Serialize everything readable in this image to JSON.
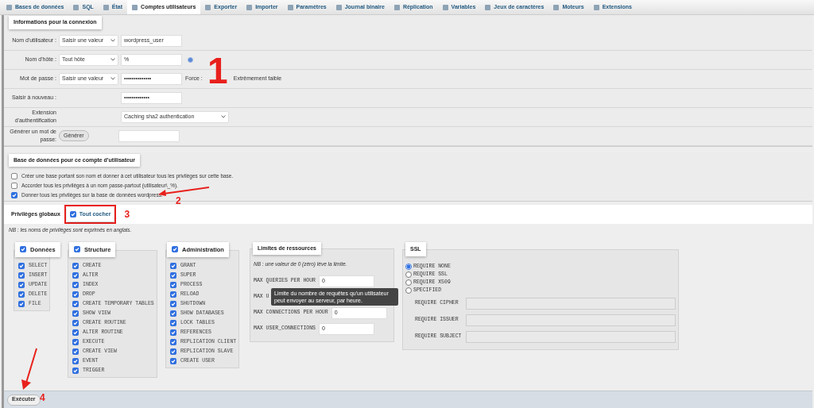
{
  "tabs": [
    {
      "label": "Bases de données",
      "selected": false
    },
    {
      "label": "SQL",
      "selected": false
    },
    {
      "label": "État",
      "selected": false
    },
    {
      "label": "Comptes utilisateurs",
      "selected": true
    },
    {
      "label": "Exporter",
      "selected": false
    },
    {
      "label": "Importer",
      "selected": false
    },
    {
      "label": "Paramètres",
      "selected": false
    },
    {
      "label": "Journal binaire",
      "selected": false
    },
    {
      "label": "Réplication",
      "selected": false
    },
    {
      "label": "Variables",
      "selected": false
    },
    {
      "label": "Jeux de caractères",
      "selected": false
    },
    {
      "label": "Moteurs",
      "selected": false
    },
    {
      "label": "Extensions",
      "selected": false
    }
  ],
  "connection": {
    "legend": "Informations pour la connexion",
    "rows": [
      {
        "kind": "select_input",
        "label": "Nom d'utilisateur :",
        "select": "Saisir une valeur",
        "value": "wordpress_user",
        "help": false
      },
      {
        "kind": "select_input",
        "label": "Nom d'hôte :",
        "select": "Tout hôte",
        "value": "%",
        "help": true
      },
      {
        "kind": "password",
        "label": "Mot de passe :",
        "select": "Saisir une valeur",
        "value": "••••••••••••••",
        "strength_label": "Force :",
        "strength": "Extrêmement faible"
      },
      {
        "kind": "input",
        "label": "Saisir à nouveau :",
        "value": "•••••••••••••"
      },
      {
        "kind": "select",
        "label": "Extension d'authentification",
        "select": "Caching sha2 authentication"
      },
      {
        "kind": "generate",
        "label": "Générer un mot de passe:",
        "button": "Générer"
      }
    ]
  },
  "database": {
    "legend": "Base de données pour ce compte d'utilisateur",
    "options": [
      {
        "label": "Créer une base portant son nom et donner à cet utilisateur tous les privilèges sur cette base.",
        "checked": false
      },
      {
        "label": "Accorder tous les privilèges à un nom passe-partout (utilisateur\\_%).",
        "checked": false
      },
      {
        "label": "Donner tous les privilèges sur la base de données wordpress.",
        "checked": true
      }
    ]
  },
  "privileges": {
    "legend": "Privilèges globaux",
    "check_all": {
      "label": "Tout cocher",
      "checked": true
    },
    "note": "NB : les noms de privilèges sont exprimés en anglais.",
    "groups": [
      {
        "title": "Données",
        "checked": true,
        "items": [
          {
            "name": "SELECT",
            "checked": true
          },
          {
            "name": "INSERT",
            "checked": true
          },
          {
            "name": "UPDATE",
            "checked": true
          },
          {
            "name": "DELETE",
            "checked": true
          },
          {
            "name": "FILE",
            "checked": true
          }
        ]
      },
      {
        "title": "Structure",
        "checked": true,
        "items": [
          {
            "name": "CREATE",
            "checked": true
          },
          {
            "name": "ALTER",
            "checked": true
          },
          {
            "name": "INDEX",
            "checked": true
          },
          {
            "name": "DROP",
            "checked": true
          },
          {
            "name": "CREATE TEMPORARY TABLES",
            "checked": true
          },
          {
            "name": "SHOW VIEW",
            "checked": true
          },
          {
            "name": "CREATE ROUTINE",
            "checked": true
          },
          {
            "name": "ALTER ROUTINE",
            "checked": true
          },
          {
            "name": "EXECUTE",
            "checked": true
          },
          {
            "name": "CREATE VIEW",
            "checked": true
          },
          {
            "name": "EVENT",
            "checked": true
          },
          {
            "name": "TRIGGER",
            "checked": true
          }
        ]
      },
      {
        "title": "Administration",
        "checked": true,
        "items": [
          {
            "name": "GRANT",
            "checked": true
          },
          {
            "name": "SUPER",
            "checked": true
          },
          {
            "name": "PROCESS",
            "checked": true
          },
          {
            "name": "RELOAD",
            "checked": true
          },
          {
            "name": "SHUTDOWN",
            "checked": true
          },
          {
            "name": "SHOW DATABASES",
            "checked": true
          },
          {
            "name": "LOCK TABLES",
            "checked": true
          },
          {
            "name": "REFERENCES",
            "checked": true
          },
          {
            "name": "REPLICATION CLIENT",
            "checked": true
          },
          {
            "name": "REPLICATION SLAVE",
            "checked": true
          },
          {
            "name": "CREATE USER",
            "checked": true
          }
        ]
      }
    ]
  },
  "resources": {
    "legend": "Limites de ressources",
    "note": "NB : une valeur de 0 (zéro) lève la limite.",
    "rows": [
      {
        "label": "MAX QUERIES PER HOUR",
        "value": "0"
      },
      {
        "label": "MAX U"
      },
      {
        "label": "MAX CONNECTIONS PER HOUR",
        "value": "0"
      },
      {
        "label": "MAX USER_CONNECTIONS",
        "value": "0"
      }
    ],
    "tooltip": "Limite du nombre de requêtes qu'un utilisateur peut envoyer au serveur, par heure."
  },
  "ssl": {
    "legend": "SSL",
    "options": [
      {
        "label": "REQUIRE NONE",
        "selected": true
      },
      {
        "label": "REQUIRE SSL",
        "selected": false
      },
      {
        "label": "REQUIRE X509",
        "selected": false
      },
      {
        "label": "SPECIFIED",
        "selected": false
      }
    ],
    "fields": [
      {
        "label": "REQUIRE CIPHER"
      },
      {
        "label": "REQUIRE ISSUER"
      },
      {
        "label": "REQUIRE SUBJECT"
      }
    ]
  },
  "footer": {
    "button": "Exécuter"
  },
  "annotations": [
    {
      "label": "1"
    },
    {
      "label": "2"
    },
    {
      "label": "3"
    },
    {
      "label": "4"
    }
  ]
}
